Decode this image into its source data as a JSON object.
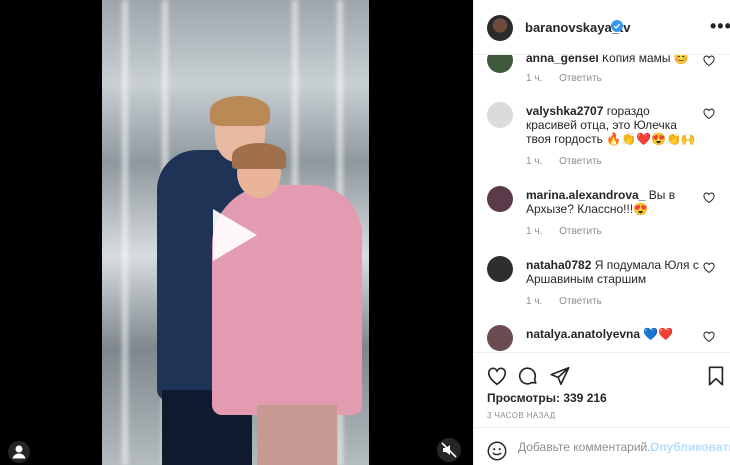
{
  "header": {
    "username": "baranovskaya_tv",
    "more_label": "•••"
  },
  "comments": [
    {
      "user": "anna_gensel",
      "text": "Копия мамы 😊",
      "time": "1 ч.",
      "reply": "Ответить"
    },
    {
      "user": "valyshka2707",
      "text": "гораздо красивей отца, это Юлечка твоя гордость 🔥👏❤️😍👏🙌",
      "time": "1 ч.",
      "reply": "Ответить"
    },
    {
      "user": "marina.alexandrova_",
      "text": "Вы в Архызе? Классно!!!😍",
      "time": "1 ч.",
      "reply": "Ответить"
    },
    {
      "user": "nataha0782",
      "text": "Я подумала Юля с Аршавиным старшим",
      "time": "1 ч.",
      "reply": "Ответить"
    },
    {
      "user": "natalya.anatolyevna",
      "text": "💙❤️",
      "time": "",
      "reply": ""
    }
  ],
  "stats": {
    "views": "Просмотры: 339 216",
    "time_ago": "3 ЧАСОВ НАЗАД"
  },
  "add_comment": {
    "placeholder": "Добавьте комментарий...",
    "post_label": "Опубликовать"
  },
  "colors": {
    "verified": "#3897f0",
    "link_disabled": "#b2dffc",
    "muted": "#8e8e8e"
  }
}
